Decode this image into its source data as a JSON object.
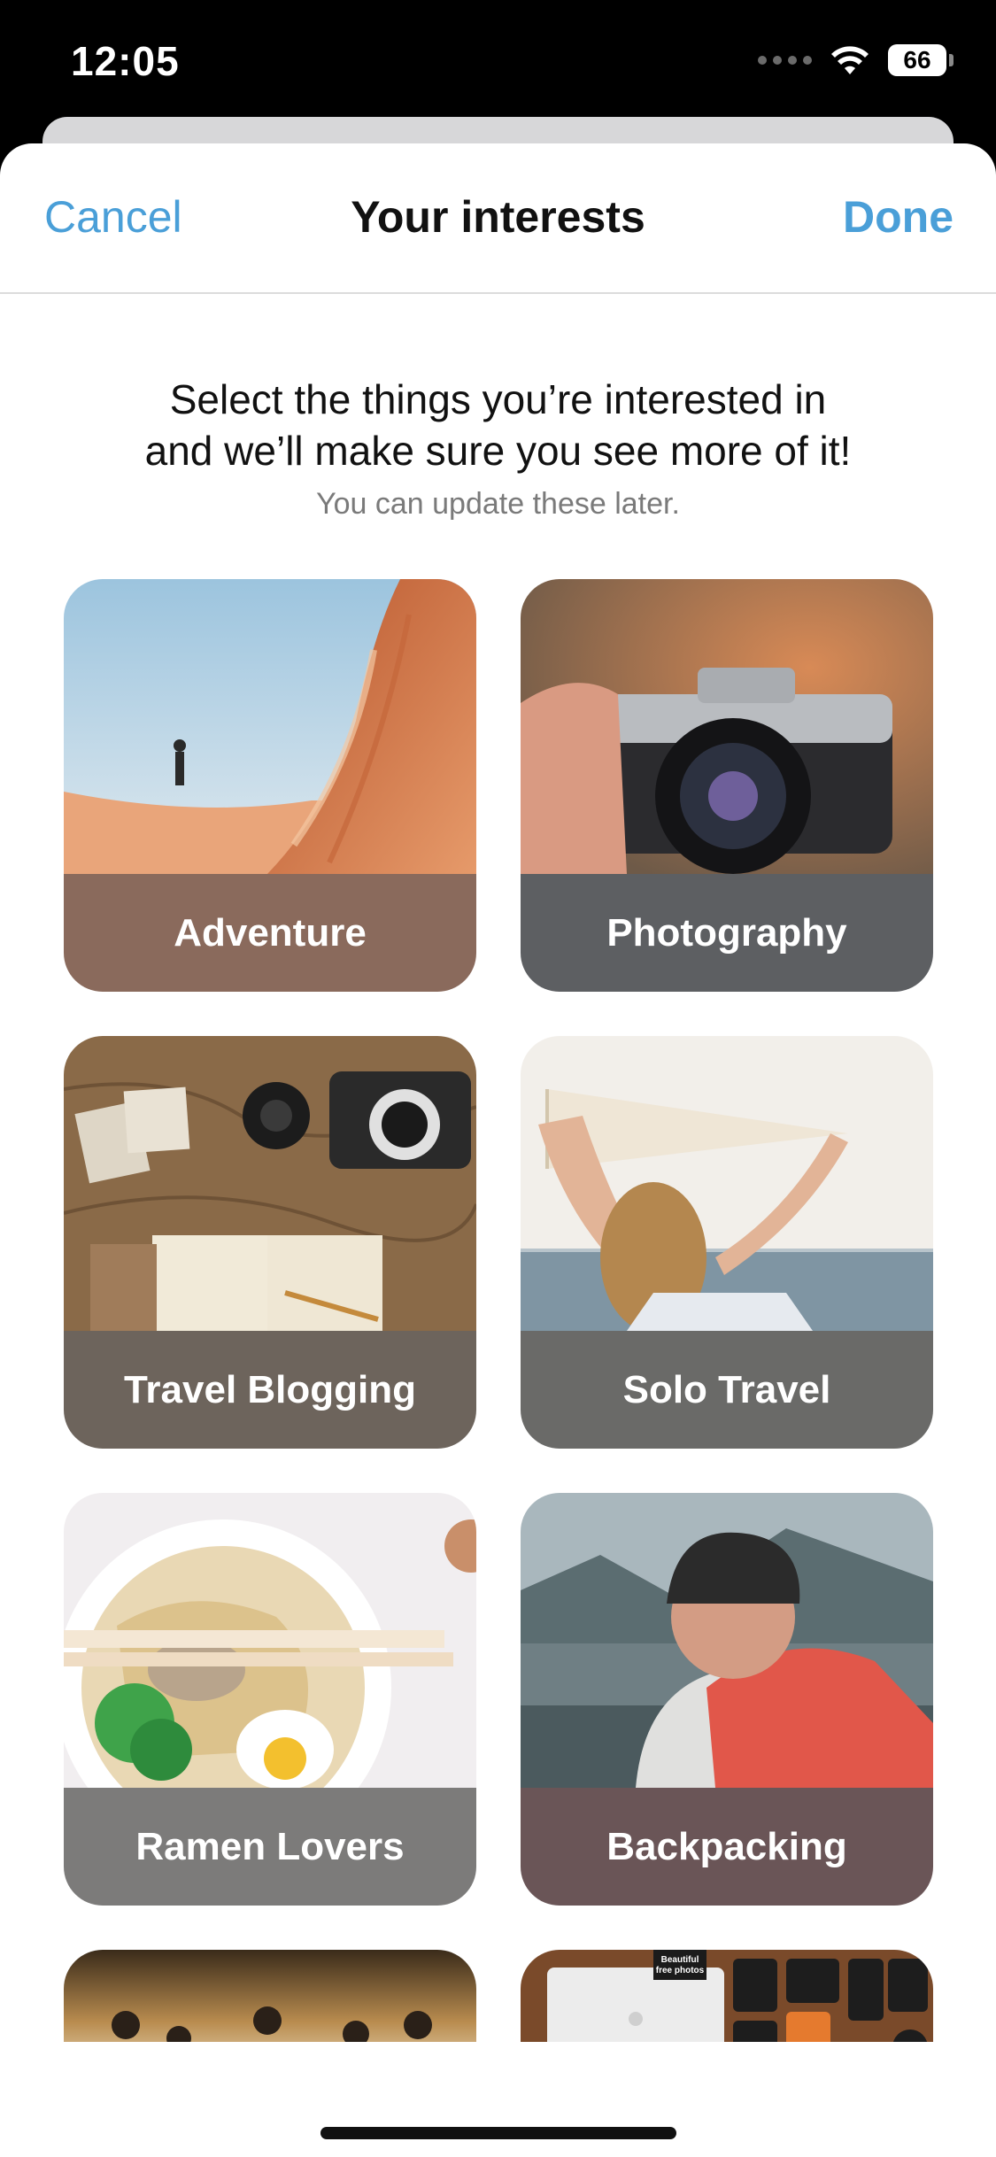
{
  "status_bar": {
    "time": "12:05",
    "battery": "66"
  },
  "nav": {
    "cancel": "Cancel",
    "title": "Your interests",
    "done": "Done"
  },
  "intro": {
    "line1": "Select the things you’re interested in",
    "line2": "and we’ll make sure you see more of it!",
    "subtitle": "You can update these later."
  },
  "colors": {
    "accent": "#4a9fd8"
  },
  "interests": [
    {
      "label": "Adventure",
      "banner_color": "#8a6a5c"
    },
    {
      "label": "Photography",
      "banner_color": "#5d5f62"
    },
    {
      "label": "Travel Blogging",
      "banner_color": "#6d645c"
    },
    {
      "label": "Solo Travel",
      "banner_color": "#6a6a68"
    },
    {
      "label": "Ramen Lovers",
      "banner_color": "#7c7b7a"
    },
    {
      "label": "Backpacking",
      "banner_color": "#6a5557"
    }
  ],
  "partial_tiles": [
    "people-at-lake-photo",
    "gear-flatlay-photo"
  ],
  "partial_tile_texts": {
    "sticker_line1": "Beautiful",
    "sticker_line2": "free photos"
  }
}
